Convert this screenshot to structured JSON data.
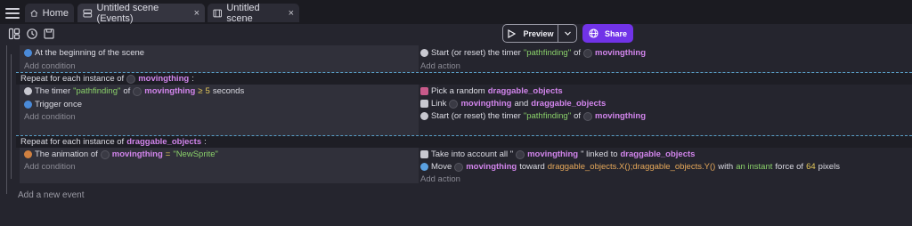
{
  "tabs": [
    {
      "label": "Home",
      "icon": "home-icon"
    },
    {
      "label": "Untitled scene (Events)",
      "icon": "events-icon",
      "close": "×"
    },
    {
      "label": "Untitled scene",
      "icon": "scene-icon",
      "close": "×"
    }
  ],
  "toolbar": {
    "preview_label": "Preview",
    "share_label": "Share"
  },
  "event1": {
    "condition": "At the beginning of the scene",
    "add_condition": "Add condition",
    "action": {
      "text": "Start (or reset) the timer",
      "timer": "\"pathfinding\"",
      "of": "of",
      "object": "movingthing"
    },
    "add_action": "Add action"
  },
  "repeat1": {
    "header_prefix": "Repeat for each instance of",
    "header_object": "movingthing",
    "header_suffix": ":",
    "cond1": {
      "text1": "The timer",
      "timer": "\"pathfinding\"",
      "of": "of",
      "object": "movingthing",
      "op": "≥",
      "value": "5",
      "unit": "seconds"
    },
    "cond2": "Trigger once",
    "add_condition": "Add condition",
    "act1": {
      "text": "Pick a random",
      "object": "draggable_objects"
    },
    "act2": {
      "text": "Link",
      "object1": "movingthing",
      "and": "and",
      "object2": "draggable_objects"
    },
    "act3": {
      "text": "Start (or reset) the timer",
      "timer": "\"pathfinding\"",
      "of": "of",
      "object": "movingthing"
    }
  },
  "repeat2": {
    "header_prefix": "Repeat for each instance of",
    "header_object": "draggable_objects",
    "header_suffix": ":",
    "cond1": {
      "text1": "The animation of",
      "object": "movingthing",
      "op": "=",
      "value": "\"NewSprite\""
    },
    "add_condition": "Add condition",
    "act1": {
      "text1": "Take into account all \"",
      "object1": "movingthing",
      "text2": "\" linked to",
      "object2": "draggable_objects"
    },
    "act2": {
      "text1": "Move",
      "object1": "movingthing",
      "text2": "toward",
      "expr": "draggable_objects.X();draggable_objects.Y()",
      "text3": "with",
      "instant": "an instant",
      "text4": "force of",
      "force": "64",
      "text5": "pixels"
    },
    "add_action": "Add action"
  },
  "add_event": "Add a new event",
  "colors": {
    "accent": "#7133e8",
    "object": "#d285ec",
    "string": "#8ad06a",
    "number": "#e6c95a"
  }
}
